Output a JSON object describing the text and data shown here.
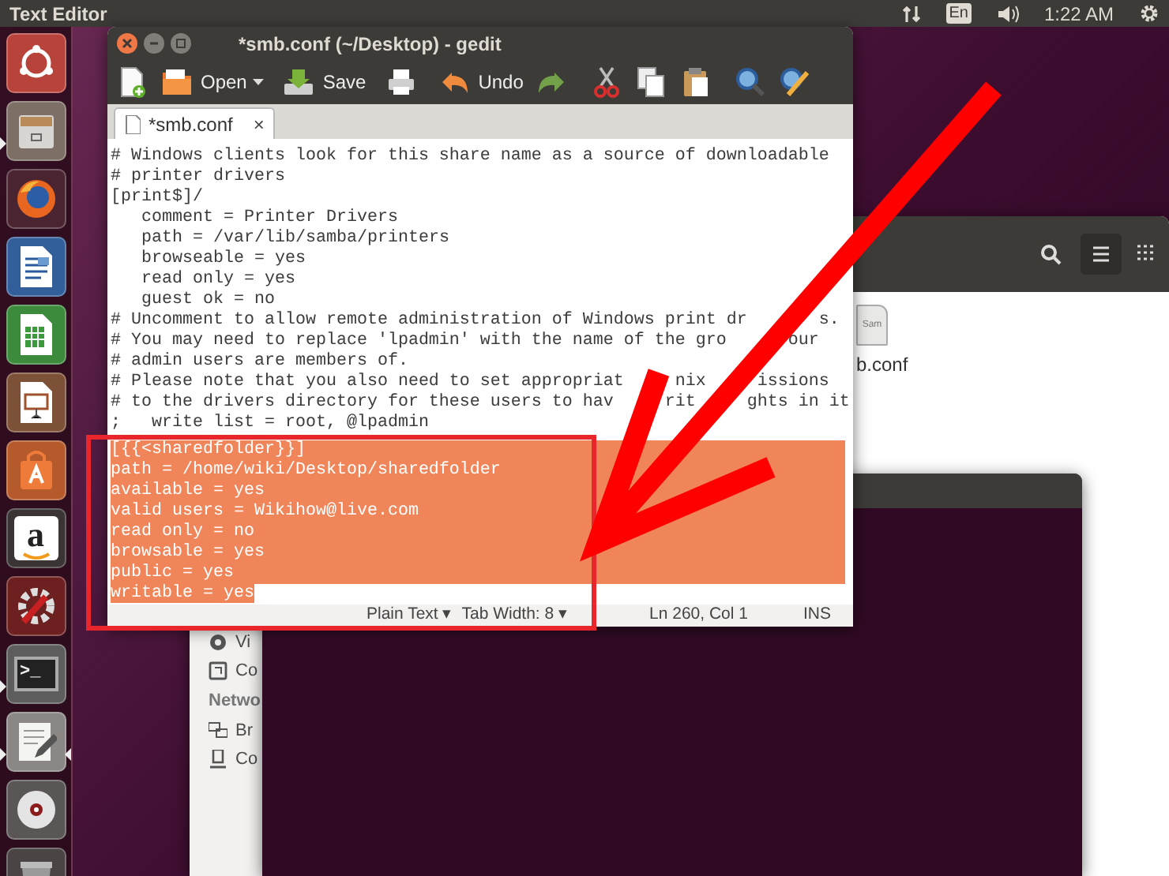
{
  "top_panel": {
    "title": "Text Editor",
    "keyboard": "En",
    "clock": "1:22 AM"
  },
  "launcher": [
    {
      "kind": "dash",
      "running": false,
      "focused": false
    },
    {
      "kind": "files",
      "running": true,
      "focused": false
    },
    {
      "kind": "browser",
      "running": false,
      "focused": false
    },
    {
      "kind": "writer",
      "running": false,
      "focused": false
    },
    {
      "kind": "calc",
      "running": false,
      "focused": false
    },
    {
      "kind": "impress",
      "running": false,
      "focused": false
    },
    {
      "kind": "store",
      "running": false,
      "focused": false
    },
    {
      "kind": "amazon",
      "label": "a",
      "running": false,
      "focused": false
    },
    {
      "kind": "settings",
      "running": false,
      "focused": false
    },
    {
      "kind": "terminal",
      "label": ">_",
      "running": true,
      "focused": false
    },
    {
      "kind": "editor",
      "running": true,
      "focused": true
    },
    {
      "kind": "disc",
      "running": false,
      "focused": false
    },
    {
      "kind": "trash",
      "running": false,
      "focused": false
    }
  ],
  "file_manager": {
    "header_buttons": [
      {
        "kind": "search",
        "selected": false
      },
      {
        "kind": "list",
        "selected": true
      },
      {
        "kind": "grid",
        "selected": false
      }
    ],
    "file": {
      "preview": "Sam",
      "name": "b.conf"
    },
    "sidebar": [
      {
        "kind": "places",
        "label": "Vi"
      },
      {
        "kind": "computer",
        "label": "Co"
      }
    ],
    "network_heading": "Netwo",
    "network": [
      {
        "kind": "network",
        "label": "Br"
      },
      {
        "kind": "server",
        "label": "Co"
      }
    ]
  },
  "editor": {
    "title": "*smb.conf (~/Desktop) - gedit",
    "toolbar": [
      {
        "kind": "new"
      },
      {
        "kind": "open",
        "label": "Open"
      },
      {
        "kind": "dropdown"
      },
      {
        "kind": "save",
        "label": "Save"
      },
      {
        "kind": "print"
      },
      {
        "kind": "undo",
        "label": "Undo"
      },
      {
        "kind": "redo"
      },
      {
        "kind": "cut"
      },
      {
        "kind": "copy"
      },
      {
        "kind": "paste"
      },
      {
        "kind": "find"
      },
      {
        "kind": "replace"
      }
    ],
    "tabs": [
      {
        "label": "*smb.conf",
        "close": "×",
        "selected": true
      }
    ],
    "lines": [
      {
        "text": "# Windows clients look for this share name as a source of downloadable",
        "selected": false
      },
      {
        "text": "# printer drivers",
        "selected": false
      },
      {
        "text": "[print$]/",
        "selected": false
      },
      {
        "text": "   comment = Printer Drivers",
        "selected": false
      },
      {
        "text": "   path = /var/lib/samba/printers",
        "selected": false
      },
      {
        "text": "   browseable = yes",
        "selected": false
      },
      {
        "text": "   read only = yes",
        "selected": false
      },
      {
        "text": "   guest ok = no",
        "selected": false
      },
      {
        "text": "# Uncomment to allow remote administration of Windows print dr       s.",
        "selected": false
      },
      {
        "text": "# You may need to replace 'lpadmin' with the name of the gro      our",
        "selected": false
      },
      {
        "text": "# admin users are members of.",
        "selected": false
      },
      {
        "text": "# Please note that you also need to set appropriat     nix     issions",
        "selected": false
      },
      {
        "text": "# to the drivers directory for these users to hav     rit     ghts in it",
        "selected": false
      },
      {
        "text": ";   write list = root, @lpadmin",
        "selected": false
      },
      {
        "text": "[{{<sharedfolder}}]",
        "selected": true
      },
      {
        "text": "path = /home/wiki/Desktop/sharedfolder",
        "selected": true
      },
      {
        "text": "available = yes",
        "selected": true
      },
      {
        "text": "valid users = Wikihow@live.com",
        "selected": true
      },
      {
        "text": "read only = no",
        "selected": true
      },
      {
        "text": "browsable = yes",
        "selected": true
      },
      {
        "text": "public = yes",
        "selected": true
      },
      {
        "text": "writable = yes",
        "selected": true
      }
    ],
    "status_bar": [
      "Plain Text ▾",
      "Tab Width: 8 ▾",
      "Ln 260, Col 1",
      "INS"
    ]
  }
}
